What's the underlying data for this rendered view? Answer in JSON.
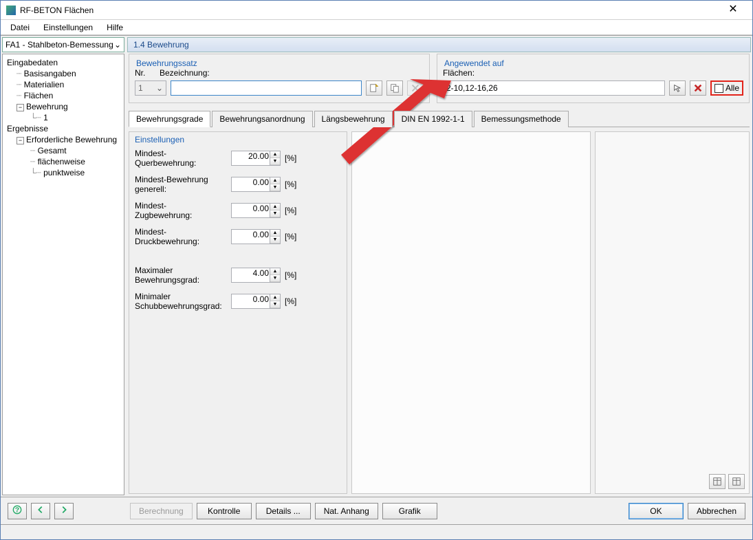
{
  "window": {
    "title": "RF-BETON Flächen"
  },
  "menu": {
    "datei": "Datei",
    "einstellungen": "Einstellungen",
    "hilfe": "Hilfe"
  },
  "sidebar": {
    "combo": "FA1 - Stahlbeton-Bemessung",
    "eingabedaten": "Eingabedaten",
    "basisangaben": "Basisangaben",
    "materialien": "Materialien",
    "flaechen": "Flächen",
    "bewehrung": "Bewehrung",
    "bewehrung_1": "1",
    "ergebnisse": "Ergebnisse",
    "erf_bewehrung": "Erforderliche Bewehrung",
    "gesamt": "Gesamt",
    "flaechenweise": "flächenweise",
    "punktweise": "punktweise"
  },
  "header": {
    "section": "1.4 Bewehrung"
  },
  "bewehrungssatz": {
    "legend": "Bewehrungssatz",
    "nr_label": "Nr.",
    "nr_value": "1",
    "bez_label": "Bezeichnung:",
    "bez_value": ""
  },
  "angewendet": {
    "legend": "Angewendet auf",
    "flaechen_label": "Flächen:",
    "flaechen_value": "2-10,12-16,26",
    "alle": "Alle"
  },
  "tabs": {
    "t1": "Bewehrungsgrade",
    "t2": "Bewehrungsanordnung",
    "t3": "Längsbewehrung",
    "t4": "DIN EN 1992-1-1",
    "t5": "Bemessungsmethode"
  },
  "settings": {
    "legend": "Einstellungen",
    "rows": [
      {
        "label": "Mindest-\nQuerbewehrung:",
        "value": "20.00",
        "unit": "[%]"
      },
      {
        "label": "Mindest-Bewehrung\ngenerell:",
        "value": "0.00",
        "unit": "[%]"
      },
      {
        "label": "Mindest-\nZugbewehrung:",
        "value": "0.00",
        "unit": "[%]"
      },
      {
        "label": "Mindest-\nDruckbewehrung:",
        "value": "0.00",
        "unit": "[%]"
      },
      {
        "label": "Maximaler\nBewehrungsgrad:",
        "value": "4.00",
        "unit": "[%]"
      },
      {
        "label": "Minimaler\nSchubbewehrungsgrad:",
        "value": "0.00",
        "unit": "[%]"
      }
    ]
  },
  "buttons": {
    "help": "?",
    "berechnung": "Berechnung",
    "kontrolle": "Kontrolle",
    "details": "Details ...",
    "nat_anhang": "Nat. Anhang",
    "grafik": "Grafik",
    "ok": "OK",
    "abbrechen": "Abbrechen"
  }
}
